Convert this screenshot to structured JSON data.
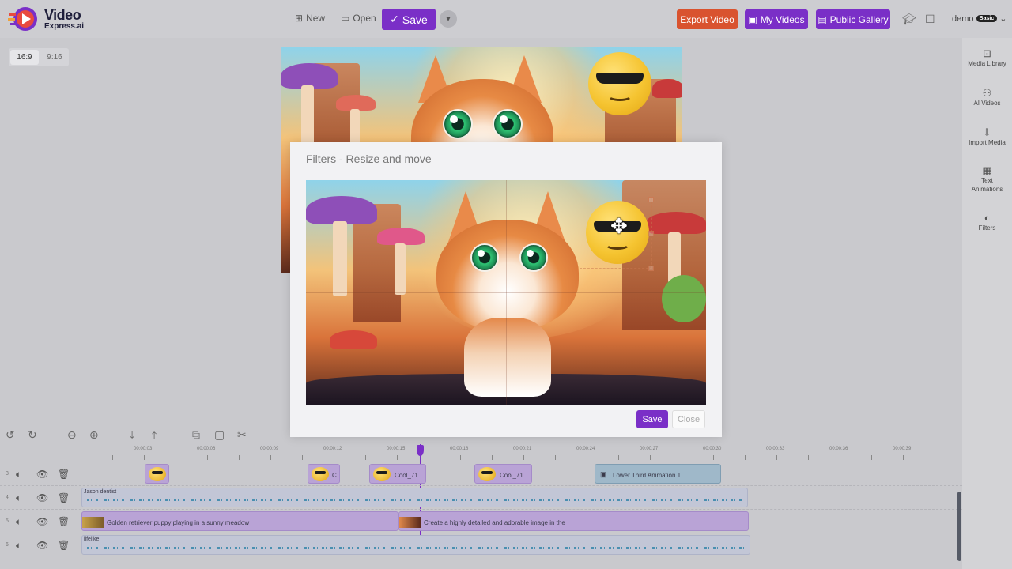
{
  "brand": {
    "line1": "Video",
    "line2": "Express.ai"
  },
  "toolbar": {
    "new_label": "New",
    "open_label": "Open",
    "save_label": "Save",
    "export_label": "Export Video",
    "my_videos_label": "My Videos",
    "public_gallery_label": "Public Gallery",
    "user_name": "demo",
    "user_plan": "Basic"
  },
  "aspect": {
    "options": [
      "16:9",
      "9:16"
    ],
    "selected": "16:9"
  },
  "sidebar": {
    "items": [
      {
        "label": "Media Library",
        "icon": "media-library-icon"
      },
      {
        "label": "AI Videos",
        "icon": "robot-icon"
      },
      {
        "label": "Import Media",
        "icon": "import-icon"
      },
      {
        "label": "Text Animations",
        "icon": "film-icon"
      },
      {
        "label": "Filters",
        "icon": "filter-icon"
      }
    ]
  },
  "modal": {
    "title": "Filters - Resize and move",
    "save_label": "Save",
    "close_label": "Close"
  },
  "timeline": {
    "ticks": [
      "00:00:03",
      "00:00:06",
      "00:00:09",
      "00:00:12",
      "00:00:15",
      "00:00:18",
      "00:00:21",
      "00:00:24",
      "00:00:27",
      "00:00:30",
      "00:00:33",
      "00:00:36",
      "00:00:39"
    ],
    "tracks": [
      {
        "number": "3",
        "clips": [
          {
            "type": "emoji",
            "label": ""
          },
          {
            "type": "emoji",
            "label": "C"
          },
          {
            "type": "emoji",
            "label": "Cool_71"
          },
          {
            "type": "emoji",
            "label": "Cool_71"
          },
          {
            "type": "text",
            "label": "Lower Third Animation 1"
          }
        ]
      },
      {
        "number": "4",
        "clips": [
          {
            "type": "audio",
            "label": "Jason dentist"
          }
        ]
      },
      {
        "number": "5",
        "clips": [
          {
            "type": "video",
            "label": "Golden retriever puppy playing in a sunny meadow"
          },
          {
            "type": "video",
            "label": "Create a highly detailed and adorable image in the"
          }
        ]
      },
      {
        "number": "6",
        "clips": [
          {
            "type": "audio",
            "label": "lifelike"
          }
        ]
      }
    ]
  },
  "colors": {
    "accent": "#7a2fc7",
    "export": "#d9532f",
    "background": "#c9c9cd"
  }
}
